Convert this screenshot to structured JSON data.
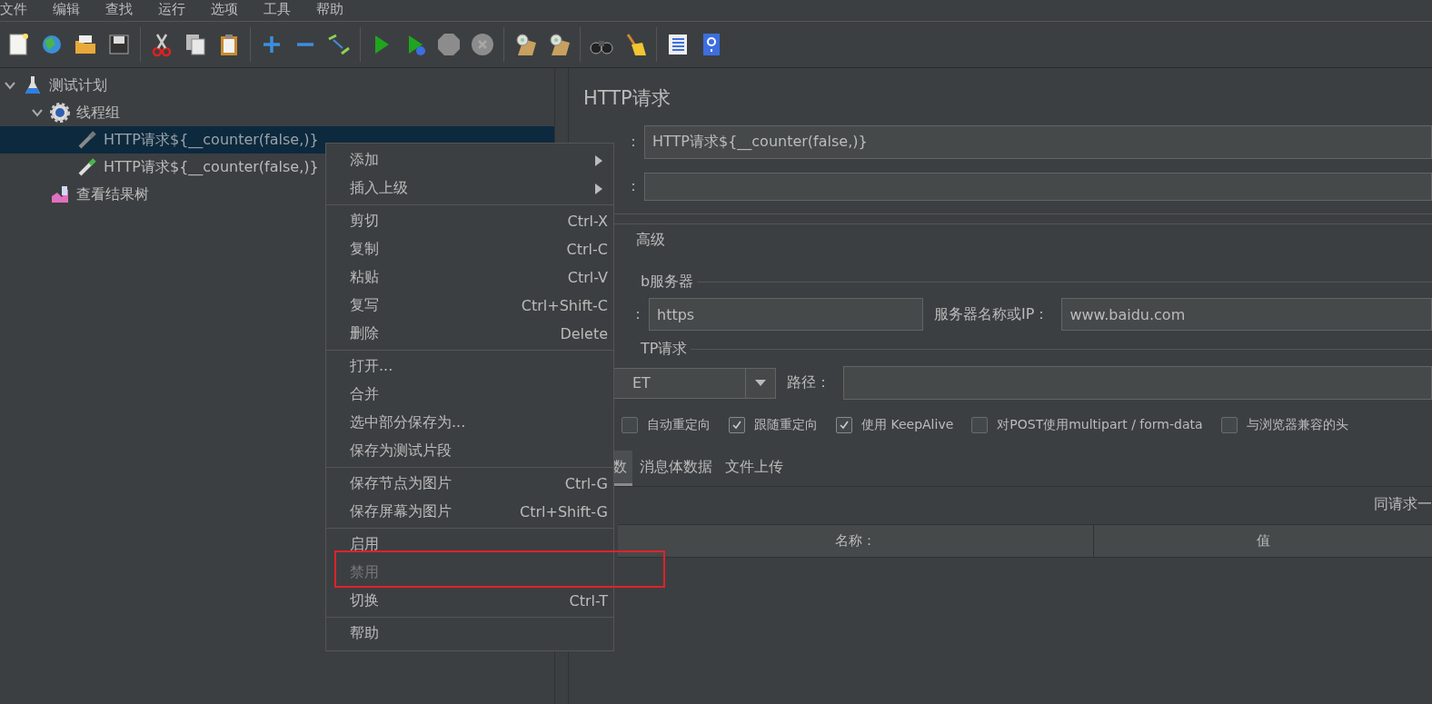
{
  "menu_bar": [
    "文件",
    "编辑",
    "查找",
    "运行",
    "选项",
    "工具",
    "帮助"
  ],
  "toolbar": [
    [
      {
        "disabled": false
      },
      {
        "disabled": false
      },
      {
        "disabled": false
      },
      {
        "disabled": false
      }
    ],
    [
      {
        "disabled": false
      },
      {
        "disabled": false
      },
      {
        "disabled": false
      }
    ],
    [
      {
        "disabled": false
      },
      {
        "disabled": false
      },
      {
        "disabled": false
      }
    ],
    [
      {
        "disabled": false
      },
      {
        "disabled": false
      },
      {
        "disabled": true
      },
      {
        "disabled": true
      }
    ],
    [
      {
        "disabled": false
      },
      {
        "disabled": false
      }
    ],
    [
      {
        "disabled": false
      },
      {
        "disabled": false
      }
    ],
    [
      {
        "disabled": false
      },
      {
        "disabled": false
      }
    ]
  ],
  "tree": [
    {
      "label": "测试计划",
      "kind": "plan",
      "expanded": true,
      "selected": false,
      "disabled": false,
      "children": [
        {
          "label": "线程组",
          "kind": "threads",
          "expanded": true,
          "selected": false,
          "disabled": false,
          "children": [
            {
              "label": "HTTP请求${__counter(false,)}",
              "kind": "sampler",
              "selected": true,
              "disabled": true
            },
            {
              "label": "HTTP请求${__counter(false,)}",
              "kind": "sampler",
              "selected": false,
              "disabled": false
            }
          ]
        },
        {
          "label": "查看结果树",
          "kind": "listener",
          "selected": false,
          "disabled": false
        }
      ]
    }
  ],
  "context_menu": [
    [
      {
        "label": "添加",
        "submenu": true,
        "disabled": false,
        "highlighted": false
      },
      {
        "label": "插入上级",
        "submenu": true,
        "disabled": false,
        "highlighted": false
      }
    ],
    [
      {
        "label": "剪切",
        "shortcut": "Ctrl-X",
        "submenu": false,
        "disabled": false,
        "highlighted": false
      },
      {
        "label": "复制",
        "shortcut": "Ctrl-C",
        "submenu": false,
        "disabled": false,
        "highlighted": false
      },
      {
        "label": "粘贴",
        "shortcut": "Ctrl-V",
        "submenu": false,
        "disabled": false,
        "highlighted": false
      },
      {
        "label": "复写",
        "shortcut": "Ctrl+Shift-C",
        "submenu": false,
        "disabled": false,
        "highlighted": false
      },
      {
        "label": "删除",
        "shortcut": "Delete",
        "submenu": false,
        "disabled": false,
        "highlighted": false
      }
    ],
    [
      {
        "label": "打开...",
        "submenu": false,
        "disabled": false,
        "highlighted": false
      },
      {
        "label": "合并",
        "submenu": false,
        "disabled": false,
        "highlighted": false
      },
      {
        "label": "选中部分保存为...",
        "submenu": false,
        "disabled": false,
        "highlighted": false
      },
      {
        "label": "保存为测试片段",
        "submenu": false,
        "disabled": false,
        "highlighted": false
      }
    ],
    [
      {
        "label": "保存节点为图片",
        "shortcut": "Ctrl-G",
        "submenu": false,
        "disabled": false,
        "highlighted": false
      },
      {
        "label": "保存屏幕为图片",
        "shortcut": "Ctrl+Shift-G",
        "submenu": false,
        "disabled": false,
        "highlighted": false
      }
    ],
    [
      {
        "label": "启用",
        "submenu": false,
        "disabled": false,
        "highlighted": false
      },
      {
        "label": "禁用",
        "submenu": false,
        "disabled": true,
        "highlighted": true
      },
      {
        "label": "切换",
        "shortcut": "Ctrl-T",
        "submenu": false,
        "disabled": false,
        "highlighted": false
      }
    ],
    [
      {
        "label": "帮助",
        "submenu": false,
        "disabled": false,
        "highlighted": false
      }
    ]
  ],
  "panel": {
    "title": "HTTP请求",
    "name_field": {
      "label": "：",
      "value": "HTTP请求${__counter(false,)}"
    },
    "comment_field": {
      "label": "："
    },
    "tabs": [
      {
        "label": "高级",
        "selected": false
      }
    ],
    "web_server": {
      "legend": "b服务器",
      "protocol": {
        "label": "：",
        "value": "https"
      },
      "server": {
        "label": "服务器名称或IP：",
        "value": "www.baidu.com"
      }
    },
    "http_request": {
      "legend": "TP请求",
      "method": "ET",
      "path": {
        "label": "路径："
      },
      "options": [
        {
          "label": "自动重定向",
          "checked": false
        },
        {
          "label": "跟随重定向",
          "checked": true
        },
        {
          "label": "使用 KeepAlive",
          "checked": true
        },
        {
          "label": "对POST使用multipart / form-data",
          "checked": false
        },
        {
          "label": "与浏览器兼容的头",
          "checked": false
        }
      ]
    },
    "body_tabs": [
      {
        "label": "数",
        "selected": true
      },
      {
        "label": "消息体数据",
        "selected": false
      },
      {
        "label": "文件上传",
        "selected": false
      }
    ],
    "note": "同请求一",
    "table": {
      "columns": [
        "名称：",
        "值"
      ]
    }
  }
}
